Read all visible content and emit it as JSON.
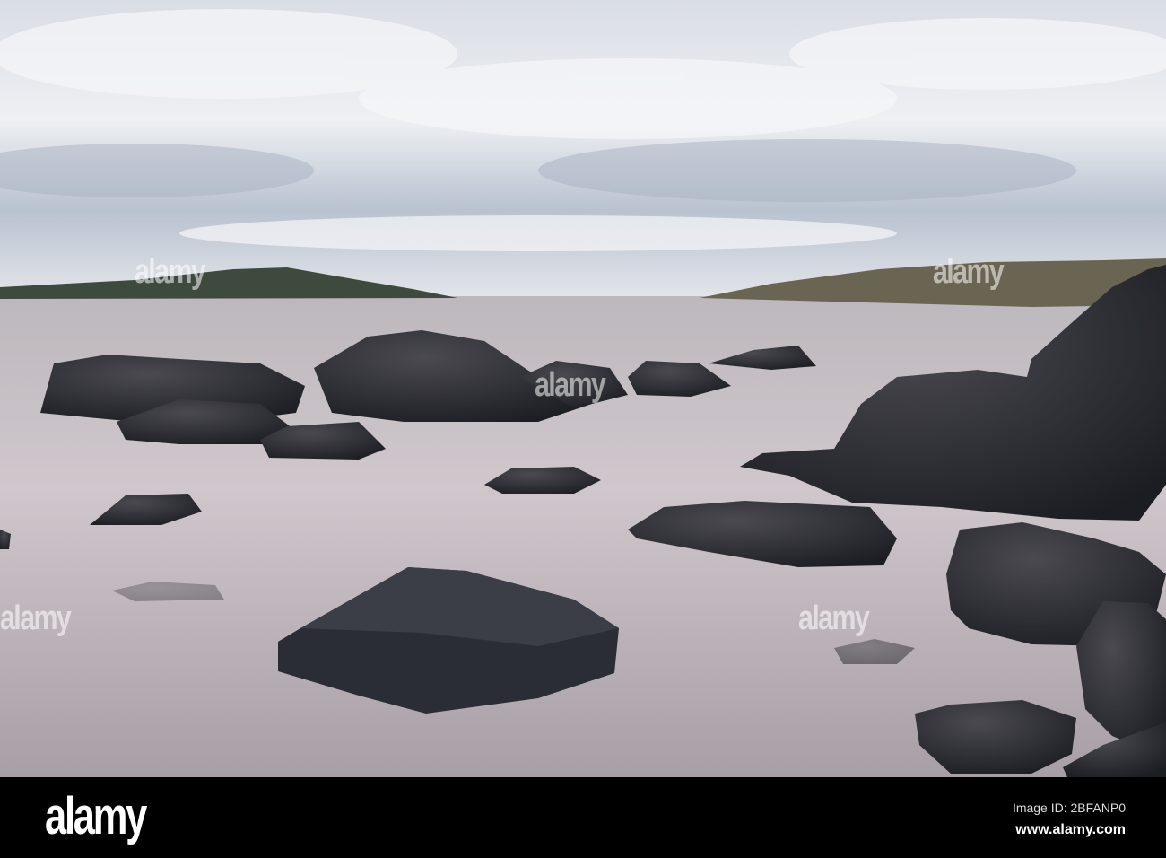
{
  "watermark": {
    "text": "alamy"
  },
  "footer": {
    "logo": "alamy",
    "image_id": "Image ID: 2BFANP0",
    "website": "www.alamy.com"
  }
}
